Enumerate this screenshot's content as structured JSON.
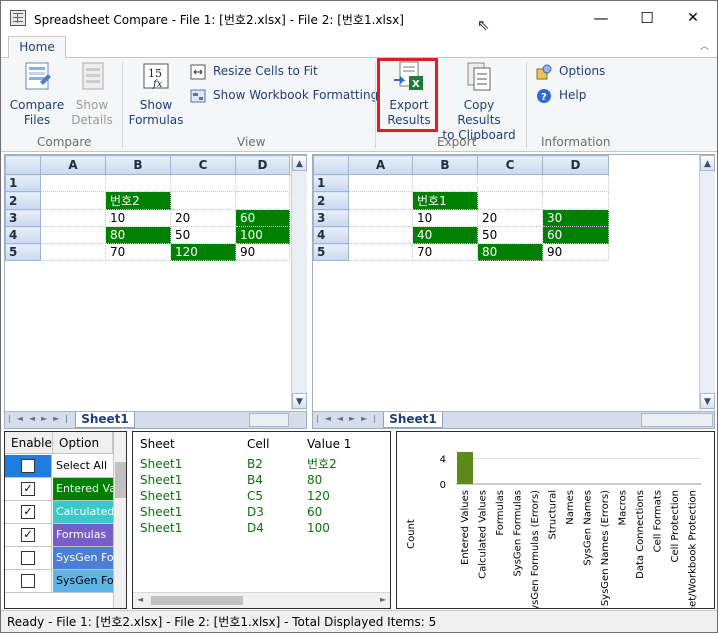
{
  "window": {
    "title": "Spreadsheet Compare - File 1: [번호2.xlsx] - File 2: [번호1.xlsx]",
    "minimize": "—",
    "maximize": "☐",
    "close": "✕"
  },
  "ribbon": {
    "tab": "Home",
    "compare_group": "Compare",
    "view_group": "View",
    "export_group": "Export",
    "info_group": "Information",
    "compare_files": [
      "Compare",
      "Files"
    ],
    "show_details": [
      "Show",
      "Details"
    ],
    "show_formulas": [
      "Show",
      "Formulas"
    ],
    "resize_cells": "Resize Cells to Fit",
    "show_formatting": "Show Workbook Formatting",
    "export_results": [
      "Export",
      "Results"
    ],
    "copy_results": [
      "Copy Results",
      "to Clipboard"
    ],
    "options": "Options",
    "help": "Help"
  },
  "sheets": {
    "columns": [
      "A",
      "B",
      "C",
      "D"
    ],
    "row_numbers": [
      "1",
      "2",
      "3",
      "4",
      "5"
    ],
    "tab_name": "Sheet1",
    "left": {
      "rows": [
        [
          "",
          "",
          "",
          ""
        ],
        [
          "",
          "번호2",
          "",
          ""
        ],
        [
          "",
          "10",
          "20",
          "60"
        ],
        [
          "",
          "80",
          "50",
          "100"
        ],
        [
          "",
          "70",
          "120",
          "90"
        ]
      ]
    },
    "right": {
      "rows": [
        [
          "",
          "",
          "",
          ""
        ],
        [
          "",
          "번호1",
          "",
          ""
        ],
        [
          "",
          "10",
          "20",
          "30"
        ],
        [
          "",
          "40",
          "50",
          "60"
        ],
        [
          "",
          "70",
          "80",
          "90"
        ]
      ]
    },
    "highlight_color": "#008000"
  },
  "options_panel": {
    "header_enable": "Enable",
    "header_option": "Option",
    "items": [
      {
        "label": "Select All",
        "checked": false,
        "color": "#ffffff",
        "text_color": "#000000",
        "chk_bg": "#1e7ee0"
      },
      {
        "label": "Entered Values",
        "checked": true,
        "color": "#008000",
        "text_color": "#ffffff",
        "chk_bg": "#ffffff"
      },
      {
        "label": "Calculated Values",
        "checked": true,
        "color": "#3cc8c8",
        "text_color": "#ffffff",
        "chk_bg": "#ffffff"
      },
      {
        "label": "Formulas",
        "checked": true,
        "color": "#7a5cc8",
        "text_color": "#ffffff",
        "chk_bg": "#ffffff"
      },
      {
        "label": "SysGen Formulas",
        "checked": false,
        "color": "#4b7fd6",
        "text_color": "#ffffff",
        "chk_bg": "#ffffff"
      },
      {
        "label": "SysGen Formulas (Errors)",
        "checked": false,
        "color": "#5fb4e6",
        "text_color": "#000000",
        "chk_bg": "#ffffff"
      }
    ]
  },
  "results": {
    "headers": [
      "Sheet",
      "Cell",
      "Value 1"
    ],
    "rows": [
      [
        "Sheet1",
        "B2",
        "번호2"
      ],
      [
        "Sheet1",
        "B4",
        "80"
      ],
      [
        "Sheet1",
        "C5",
        "120"
      ],
      [
        "Sheet1",
        "D3",
        "60"
      ],
      [
        "Sheet1",
        "D4",
        "100"
      ]
    ]
  },
  "chart_data": {
    "type": "bar",
    "ylabel": "Count",
    "categories": [
      "Entered Values",
      "Calculated Values",
      "Formulas",
      "SysGen Formulas",
      "SysGen Formulas (Errors)",
      "Structural",
      "Names",
      "SysGen Names",
      "SysGen Names (Errors)",
      "Macros",
      "Data Connections",
      "Cell Formats",
      "Cell Protection",
      "Sheet/Workbook Protection"
    ],
    "visible_categories": [
      "Entered Values",
      "Calculated Values",
      "Formulas",
      "SysGen Formulas",
      "SysGen Formulas (Errors)",
      "Structural",
      "Names",
      "SysGen Names",
      "SysGen Names (Errors)",
      "Macros",
      "Data Connections",
      "Cell Formats",
      "Cell Protection",
      "eet/Workbook Protection"
    ],
    "values": [
      5,
      0,
      0,
      0,
      0,
      0,
      0,
      0,
      0,
      0,
      0,
      0,
      0,
      0
    ],
    "y_ticks": [
      "4",
      "0"
    ],
    "bar_color": "#5e8a1a"
  },
  "status": "Ready - File 1: [번호2.xlsx] - File 2: [번호1.xlsx] - Total Displayed Items: 5"
}
